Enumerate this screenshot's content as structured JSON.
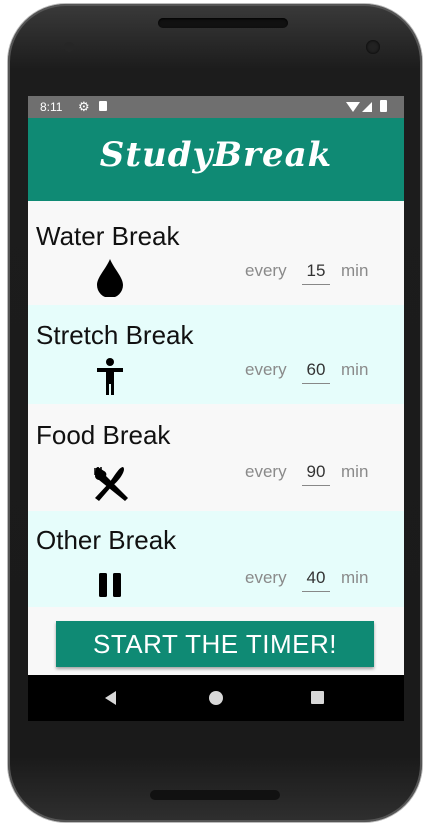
{
  "status_bar": {
    "time": "8:11",
    "icons": [
      "gear-icon",
      "sdcard-icon",
      "wifi-icon",
      "signal-icon",
      "battery-icon"
    ]
  },
  "app_bar": {
    "title": "StudyBreak",
    "color": "#0f8a74"
  },
  "breaks": [
    {
      "title": "Water Break",
      "icon": "water-drop-icon",
      "every_label": "every",
      "interval": "15",
      "unit": "min"
    },
    {
      "title": "Stretch Break",
      "icon": "person-stretch-icon",
      "every_label": "every",
      "interval": "60",
      "unit": "min"
    },
    {
      "title": "Food Break",
      "icon": "fork-knife-icon",
      "every_label": "every",
      "interval": "90",
      "unit": "min"
    },
    {
      "title": "Other Break",
      "icon": "pause-icon",
      "every_label": "every",
      "interval": "40",
      "unit": "min"
    }
  ],
  "start_button": {
    "label": "START THE TIMER!"
  },
  "colors": {
    "accent": "#0f8a74",
    "alt_row": "#e6fdfb",
    "row": "#f8f8f8"
  }
}
